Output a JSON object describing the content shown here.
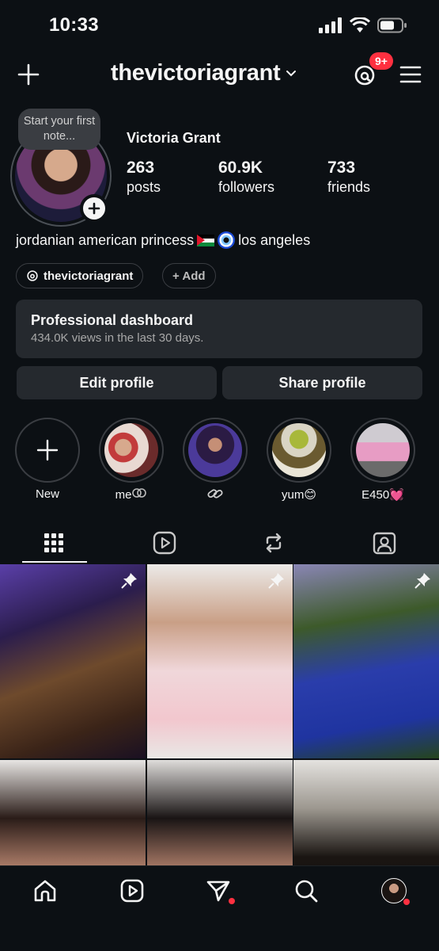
{
  "status": {
    "time": "10:33"
  },
  "header": {
    "username": "thevictoriagrant",
    "notif_count": "9+"
  },
  "profile": {
    "note_text": "Start your first note...",
    "display_name": "Victoria Grant",
    "stats": [
      {
        "num": "263",
        "label": "posts"
      },
      {
        "num": "60.9K",
        "label": "followers"
      },
      {
        "num": "733",
        "label": "friends"
      }
    ],
    "bio_part1": "jordanian american princess",
    "bio_part2": "los angeles",
    "threads_handle": "thevictoriagrant",
    "add_link": "+ Add"
  },
  "dashboard": {
    "title": "Professional dashboard",
    "subtitle": "434.0K views in the last 30 days."
  },
  "buttons": {
    "edit": "Edit profile",
    "share": "Share profile"
  },
  "highlights": [
    {
      "label": "New",
      "icon": "plus-icon"
    },
    {
      "label": "me’´˚",
      "icon": ""
    },
    {
      "label": "🔗",
      "icon": "link-icon"
    },
    {
      "label": "yum😊",
      "icon": ""
    },
    {
      "label": "E450💓",
      "icon": ""
    }
  ],
  "tabs": [
    "grid-icon",
    "reels-icon",
    "reposts-icon",
    "tagged-icon"
  ],
  "nav": [
    "home-icon",
    "reels-icon",
    "messages-icon",
    "search-icon",
    "profile-avatar"
  ],
  "colors": {
    "background": "#0c1014",
    "surface": "#25292e",
    "badge": "#ff3040"
  }
}
